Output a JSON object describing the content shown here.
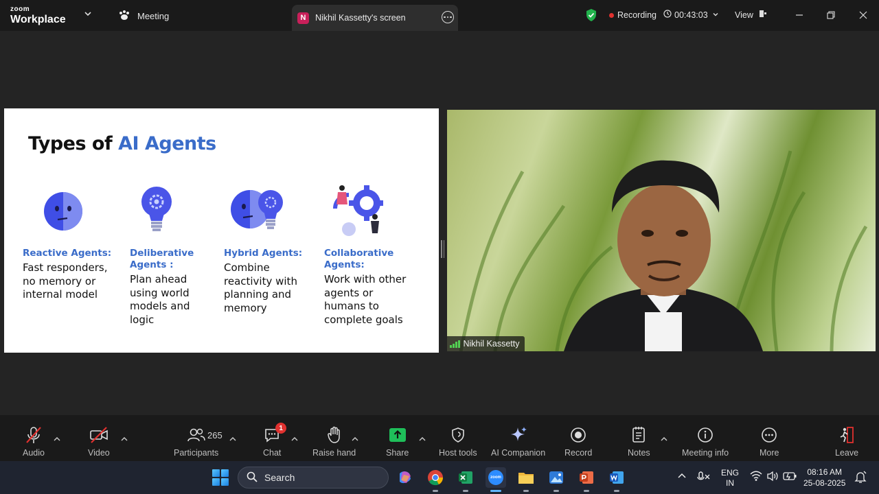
{
  "titlebar": {
    "brand_top": "zoom",
    "brand_bottom": "Workplace",
    "meeting_label": "Meeting",
    "screen_tab_badge": "N",
    "screen_tab_label": "Nikhil Kassetty's screen",
    "recording_label": "Recording",
    "timer": "00:43:03",
    "view_label": "View"
  },
  "slide": {
    "title_plain": "Types of ",
    "title_accent": "AI Agents",
    "agents": [
      {
        "head": "Reactive Agents:",
        "body": "Fast responders, no memory or internal model"
      },
      {
        "head": "Deliberative Agents :",
        "body": "Plan ahead using world models and logic"
      },
      {
        "head": "Hybrid Agents:",
        "body": "Combine reactivity with planning and memory"
      },
      {
        "head": "Collaborative Agents:",
        "body": "Work with other agents or humans to complete goals"
      }
    ]
  },
  "video": {
    "participant_name": "Nikhil Kassetty"
  },
  "toolbar": {
    "audio": "Audio",
    "video": "Video",
    "participants": "Participants",
    "participants_count": "265",
    "chat": "Chat",
    "chat_badge": "1",
    "raise_hand": "Raise hand",
    "share": "Share",
    "host_tools": "Host tools",
    "ai_companion": "AI Companion",
    "record": "Record",
    "notes": "Notes",
    "meeting_info": "Meeting info",
    "more": "More",
    "leave": "Leave"
  },
  "taskbar": {
    "search_placeholder": "Search",
    "zoom_app_label": "zoom",
    "lang_top": "ENG",
    "lang_bottom": "IN",
    "time": "08:16 AM",
    "date": "25-08-2025"
  },
  "colors": {
    "accent_blue": "#3a6cc9",
    "recording_red": "#e0312f",
    "share_green": "#1fbf5a",
    "leave_red": "#e0312f"
  }
}
